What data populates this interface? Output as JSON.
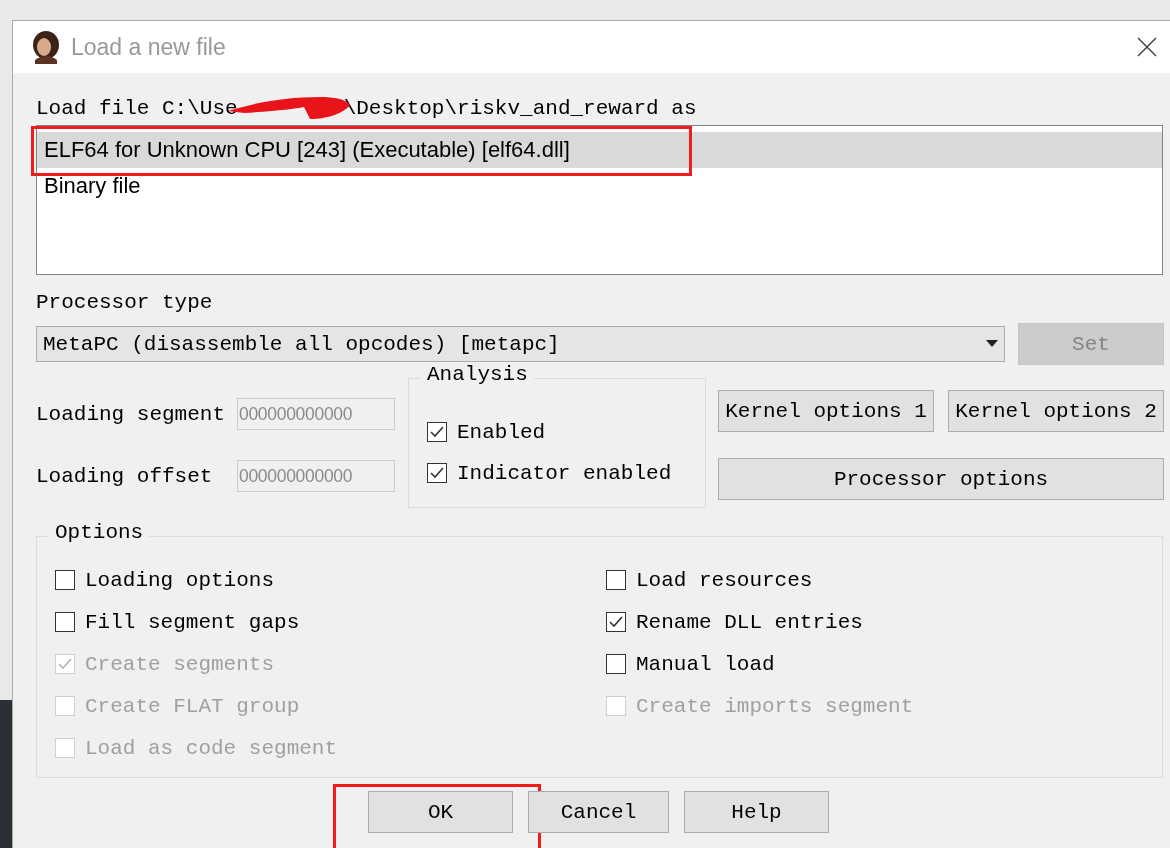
{
  "window": {
    "title": "Load a new file"
  },
  "load_file": {
    "prefix": "Load file C:\\Use",
    "suffix": "\\Desktop\\riskv_and_reward as",
    "redacted": true
  },
  "loaders": [
    {
      "label": "ELF64 for Unknown CPU [243] (Executable) [elf64.dll]",
      "selected": true,
      "highlighted": true
    },
    {
      "label": "Binary file",
      "selected": false,
      "highlighted": false
    }
  ],
  "processor_type": {
    "label": "Processor type",
    "value": "MetaPC (disassemble all opcodes) [metapc]"
  },
  "set_button": {
    "label": "Set",
    "disabled": true
  },
  "fields": [
    {
      "label": "Loading segment",
      "value": "000000000000",
      "disabled": true
    },
    {
      "label": "Loading offset",
      "value": "000000000000",
      "disabled": true
    }
  ],
  "analysis": {
    "title": "Analysis",
    "items": [
      {
        "label": "Enabled",
        "checked": true
      },
      {
        "label": "Indicator enabled",
        "checked": true
      }
    ]
  },
  "option_buttons": [
    "Kernel options 1",
    "Kernel options 2",
    "Processor options"
  ],
  "options": {
    "title": "Options",
    "left": [
      {
        "label": "Loading options",
        "checked": false,
        "disabled": false
      },
      {
        "label": "Fill segment gaps",
        "checked": false,
        "disabled": false
      },
      {
        "label": "Create segments",
        "checked": true,
        "disabled": true
      },
      {
        "label": "Create FLAT group",
        "checked": false,
        "disabled": true
      },
      {
        "label": "Load as code segment",
        "checked": false,
        "disabled": true
      }
    ],
    "right": [
      {
        "label": "Load resources",
        "checked": false,
        "disabled": false
      },
      {
        "label": "Rename DLL entries",
        "checked": true,
        "disabled": false
      },
      {
        "label": "Manual load",
        "checked": false,
        "disabled": false
      },
      {
        "label": "Create imports segment",
        "checked": false,
        "disabled": true
      }
    ]
  },
  "buttons": [
    {
      "label": "OK",
      "highlighted": true
    },
    {
      "label": "Cancel",
      "highlighted": false
    },
    {
      "label": "Help",
      "highlighted": false
    }
  ]
}
